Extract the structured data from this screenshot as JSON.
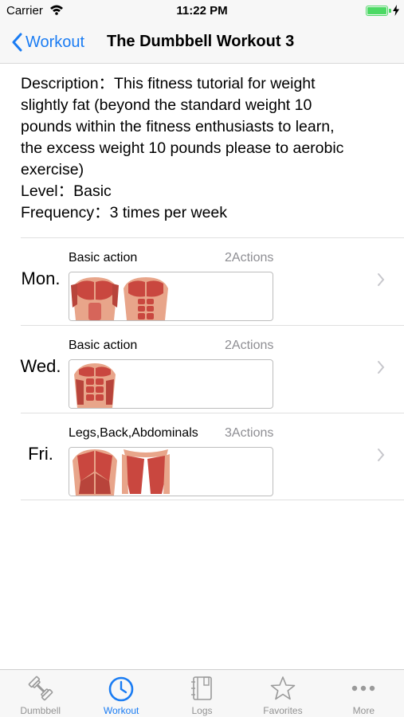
{
  "status_bar": {
    "carrier": "Carrier",
    "time": "11:22 PM"
  },
  "nav": {
    "back_label": "Workout",
    "title": "The Dumbbell Workout 3"
  },
  "description": {
    "lines": [
      "Description：This fitness tutorial for weight",
      "slightly fat (beyond the standard weight 10",
      "pounds within the fitness enthusiasts to learn,",
      "the excess weight 10 pounds please to aerobic",
      "exercise)",
      "Level：Basic",
      "Frequency：3 times per week"
    ]
  },
  "days": [
    {
      "day": "Mon.",
      "action_name": "Basic action",
      "action_count": "2Actions",
      "images": [
        "chest-muscles-image",
        "chest-abs-muscles-image"
      ]
    },
    {
      "day": "Wed.",
      "action_name": "Basic action",
      "action_count": "2Actions",
      "images": [
        "abs-muscles-image"
      ]
    },
    {
      "day": "Fri.",
      "action_name": "Legs,Back,Abdominals",
      "action_count": "3Actions",
      "images": [
        "back-muscles-image",
        "legs-muscles-image"
      ]
    }
  ],
  "tab_bar": {
    "tabs": [
      {
        "label": "Dumbbell",
        "icon": "dumbbell-icon",
        "active": false
      },
      {
        "label": "Workout",
        "icon": "clock-icon",
        "active": true
      },
      {
        "label": "Logs",
        "icon": "notebook-icon",
        "active": false
      },
      {
        "label": "Favorites",
        "icon": "star-icon",
        "active": false
      },
      {
        "label": "More",
        "icon": "more-dots-icon",
        "active": false
      }
    ]
  },
  "colors": {
    "accent": "#1a7cf3",
    "battery": "#4cd964",
    "muscle": "#d9534f"
  }
}
